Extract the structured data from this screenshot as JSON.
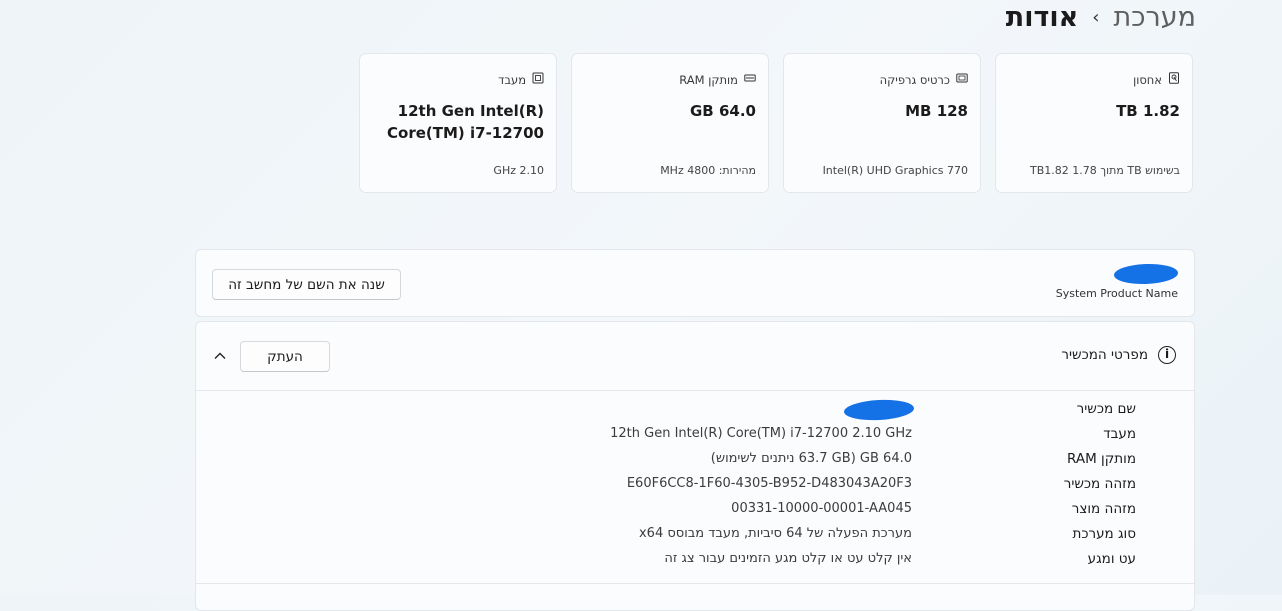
{
  "breadcrumb": {
    "parent": "מערכת",
    "separator": "›",
    "current": "אודות"
  },
  "specs": [
    {
      "label": "אחסון",
      "icon": "storage-icon",
      "value": "1.82 TB",
      "sub": "בשימוש TB  מתוך 1.78 TB1.82"
    },
    {
      "label": "כרטיס גרפיקה",
      "icon": "gpu-icon",
      "value": "128 MB",
      "sub": "Intel(R) UHD Graphics 770"
    },
    {
      "label": "מותקן RAM",
      "icon": "ram-icon",
      "value": "64.0 GB",
      "sub": "מהירות: 4800 MHz"
    },
    {
      "label": "מעבד",
      "icon": "cpu-icon",
      "value": "12th Gen Intel(R) Core(TM) i7-12700",
      "sub": "2.10 GHz"
    }
  ],
  "name_card": {
    "product_name_label": "System Product Name",
    "rename_button": "שנה את השם של מחשב זה"
  },
  "device_specs": {
    "title": "מפרטי המכשיר",
    "copy_button": "העתק",
    "rows": [
      {
        "label": "שם מכשיר",
        "value": ""
      },
      {
        "label": "מעבד",
        "value": "12th Gen Intel(R) Core(TM) i7-12700   2.10 GHz"
      },
      {
        "label": "מותקן RAM",
        "value": "64.0 GB (63.7 GB ניתנים לשימוש)"
      },
      {
        "label": "מזהה מכשיר",
        "value": "E60F6CC8-1F60-4305-B952-D483043A20F3"
      },
      {
        "label": "מזהה מוצר",
        "value": "00331-10000-00001-AA045"
      },
      {
        "label": "סוג מערכת",
        "value": "מערכת הפעלה של 64 סיביות, מעבד מבוסס x64"
      },
      {
        "label": "עט ומגע",
        "value": "אין קלט עט או קלט מגע הזמינים עבור צג זה"
      }
    ]
  }
}
